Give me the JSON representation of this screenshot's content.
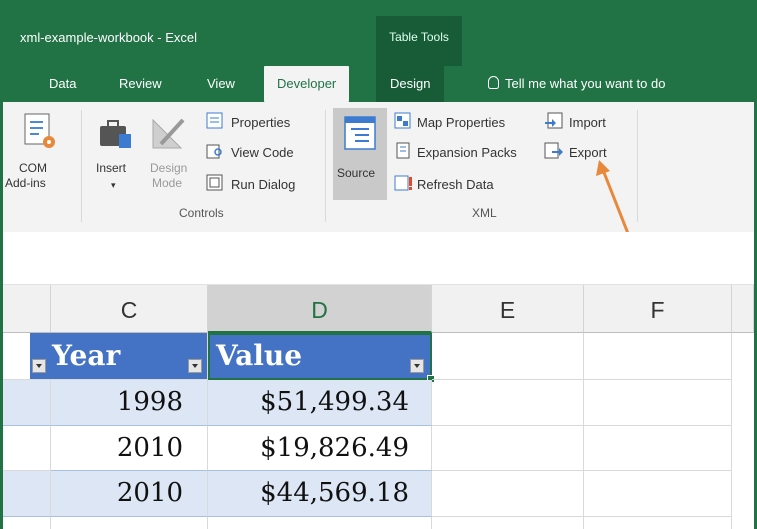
{
  "window": {
    "title": "xml-example-workbook - Excel",
    "context_tab_group": "Table Tools"
  },
  "tabs": {
    "data": "Data",
    "review": "Review",
    "view": "View",
    "developer": "Developer",
    "design": "Design"
  },
  "tell_me": "Tell me what you want to do",
  "ribbon": {
    "com_addins_line1": "COM",
    "com_addins_line2": "Add-ins",
    "insert": "Insert",
    "design_mode_line1": "Design",
    "design_mode_line2": "Mode",
    "properties": "Properties",
    "view_code": "View Code",
    "run_dialog": "Run Dialog",
    "controls_group": "Controls",
    "source": "Source",
    "map_properties": "Map Properties",
    "expansion_packs": "Expansion Packs",
    "refresh_data": "Refresh Data",
    "import": "Import",
    "export": "Export",
    "xml_group": "XML"
  },
  "grid": {
    "columns": [
      "C",
      "D",
      "E",
      "F"
    ],
    "selected_column": "D",
    "headers": [
      "Year",
      "Value"
    ],
    "rows": [
      {
        "year": "1998",
        "value": "$51,499.34"
      },
      {
        "year": "2010",
        "value": "$19,826.49"
      },
      {
        "year": "2010",
        "value": "$44,569.18"
      }
    ]
  },
  "colors": {
    "excel_green": "#217346",
    "table_header": "#4472c4",
    "band": "#dce6f4",
    "arrow": "#e8883a"
  }
}
